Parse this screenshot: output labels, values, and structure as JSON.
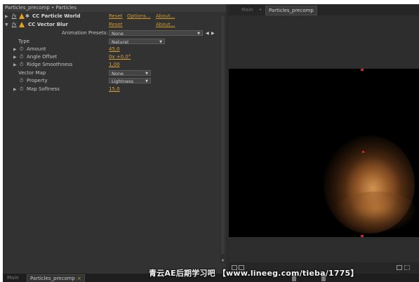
{
  "effect_controls": {
    "title": "Particles_precomp • Particles",
    "effects": [
      {
        "name": "CC Particle World",
        "reset": "Reset",
        "options": "Options...",
        "about": "About..."
      },
      {
        "name": "CC Vector Blur",
        "reset": "Reset",
        "about": "About..."
      }
    ],
    "animation_presets": {
      "label": "Animation Presets:",
      "value": "None"
    },
    "params": {
      "type": {
        "label": "Type",
        "value": "Natural"
      },
      "amount": {
        "label": "Amount",
        "value": "45,0"
      },
      "angle_offset": {
        "label": "Angle Offset",
        "value": "0x +0,0°"
      },
      "ridge_smoothness": {
        "label": "Ridge Smoothness",
        "value": "1,00"
      },
      "vector_map": {
        "label": "Vector Map",
        "value": "None"
      },
      "property": {
        "label": "Property",
        "value": "Lightness"
      },
      "map_softness": {
        "label": "Map Softness",
        "value": "15,0"
      }
    }
  },
  "comp_viewer": {
    "tabs": [
      "Main",
      "Particles_precomp"
    ],
    "active_tab": "Particles_precomp"
  },
  "timeline": {
    "tabs": [
      "Main",
      "Particles_precomp"
    ],
    "active_tab": "Particles_precomp"
  },
  "watermark": "青云AE后期学习吧 【www.lineeg.com/tieba/1775】",
  "colors": {
    "link": "#d39a2a",
    "warning": "#e8a21a",
    "handle": "#d02828",
    "smoke": "#c27a3a"
  }
}
